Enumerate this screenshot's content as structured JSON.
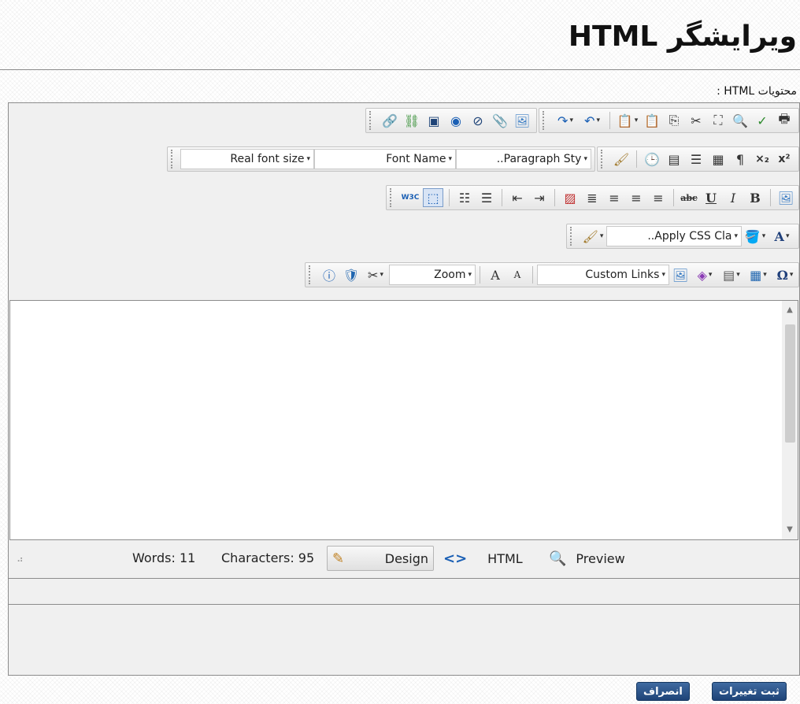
{
  "header": {
    "title": "ویرایشگر HTML",
    "contents_label": "محتویات HTML :"
  },
  "toolbars": {
    "dropdowns": {
      "real_font_size": "Real font size",
      "font_name": "Font Name",
      "paragraph_style": "..Paragraph Sty",
      "apply_css_class": "..Apply CSS Cla",
      "zoom": "Zoom",
      "custom_links": "Custom Links"
    },
    "glyphs": {
      "subscript": "×₂",
      "superscript": "x²",
      "strikethrough": "abc",
      "underline": "U",
      "italic": "I",
      "bold": "B",
      "font_color": "A",
      "omega": "Ω",
      "w3c": "W3C"
    }
  },
  "status_bar": {
    "words": "Words: 11",
    "characters": "Characters: 95",
    "design_tab": "Design",
    "html_tab": "HTML",
    "preview_tab": "Preview"
  },
  "footer": {
    "save_button": "ثبت تغییرات",
    "cancel_button": "انصراف"
  },
  "colors": {
    "button_blue": "#1f4478",
    "border_gray": "#8c8c8c",
    "toolbar_bg": "#f0f0f0"
  }
}
